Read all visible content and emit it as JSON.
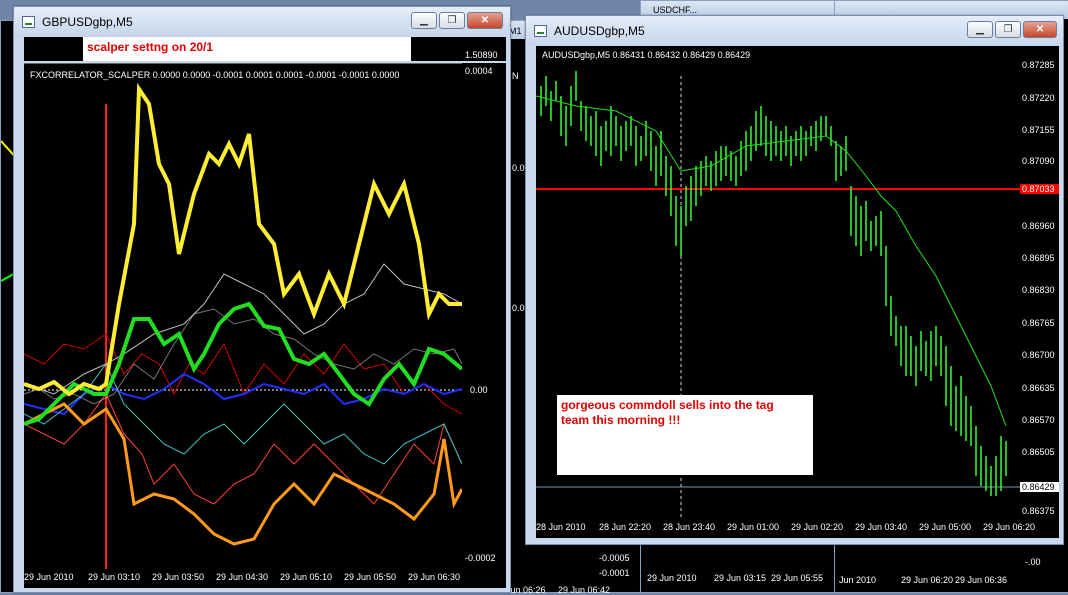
{
  "windows": {
    "gbp": {
      "title": "GBPUSDgbp,M5",
      "annotation": "scalper settng on 20/1",
      "indicator": "FXCORRELATOR_SCALPER 0.0000 0.0000 -0.0001 0.0001 0.0001 -0.0001 -0.0001 0.0000",
      "price_top": "1.50890",
      "scale": [
        "0.0004",
        "0.00",
        "-0.0002"
      ],
      "xlabels": [
        "29 Jun 2010",
        "29 Jun 03:10",
        "29 Jun 03:50",
        "29 Jun 04:30",
        "29 Jun 05:10",
        "29 Jun 05:50",
        "29 Jun 06:30"
      ]
    },
    "aud": {
      "title": "AUDUSDgbp,M5",
      "info": "AUDUSDgbp,M5  0.86431 0.86432 0.86429 0.86429",
      "annotation": "gorgeous commdoll sells into the tag team this morning !!!",
      "yticks": [
        "0.87285",
        "0.87220",
        "0.87155",
        "0.87090",
        "0.87033",
        "0.86960",
        "0.86895",
        "0.86830",
        "0.86765",
        "0.86700",
        "0.86635",
        "0.86570",
        "0.86505",
        "0.86429",
        "0.86375"
      ],
      "highlight_red": "0.87033",
      "highlight_bid": "0.86429",
      "xlabels": [
        "28 Jun 2010",
        "28 Jun 22:20",
        "28 Jun 23:40",
        "29 Jun 01:00",
        "29 Jun 02:20",
        "29 Jun 03:40",
        "29 Jun 05:00",
        "29 Jun 06:20"
      ]
    }
  },
  "background": {
    "titles": [
      "N",
      "M1",
      "USDCHF..."
    ],
    "scale_labels": [
      "0.00",
      "-0.0005",
      "-0.0001",
      "-.00"
    ],
    "dates": [
      "Jun 06:26",
      "29 Jun 06:42",
      "29 Jun 2010",
      "29 Jun 03:15",
      "29 Jun 05:55",
      "Jun 2010",
      "29 Jun 06:20",
      "29 Jun 06:36"
    ]
  }
}
